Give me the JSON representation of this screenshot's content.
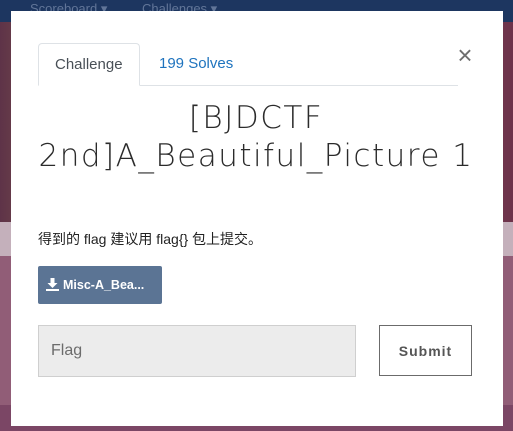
{
  "background": {
    "nav_items": [
      "Scoreboard ▾",
      "Challenges ▾"
    ]
  },
  "modal": {
    "close_label": "×",
    "tabs": [
      {
        "label": "Challenge"
      },
      {
        "label": "199 Solves"
      }
    ],
    "title": "[BJDCTF 2nd]A_Beautiful_Picture 1",
    "description": "得到的 flag 建议用 flag{} 包上提交。",
    "download": {
      "icon": "download-icon",
      "label": "Misc-A_Bea..."
    },
    "flag_input": {
      "value": "",
      "placeholder": "Flag"
    },
    "submit_label": "Submit"
  },
  "colors": {
    "nav": "#223e6e",
    "download_button": "#5b7494",
    "link": "#1e73be"
  }
}
